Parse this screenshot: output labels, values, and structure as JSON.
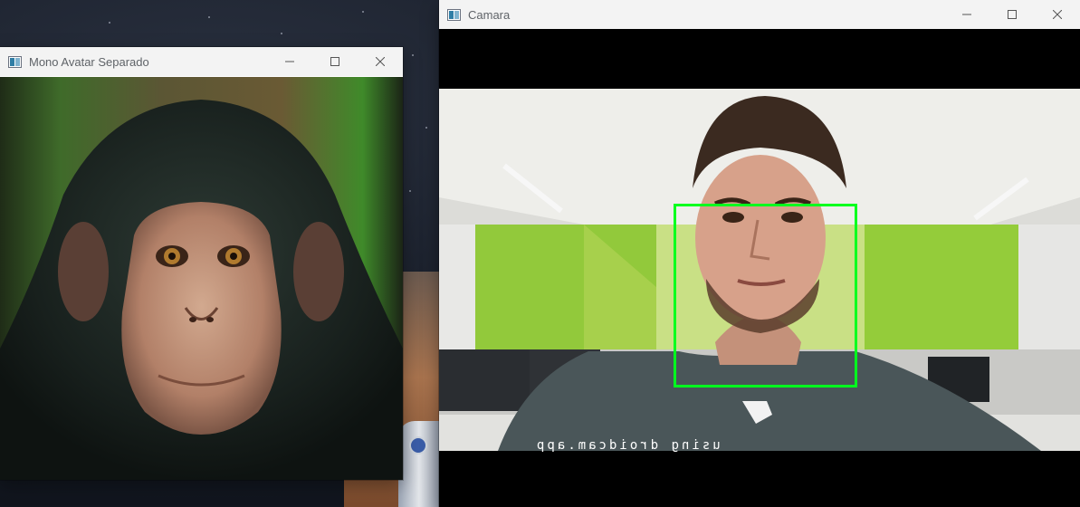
{
  "windows": {
    "avatar": {
      "title": "Mono Avatar Separado",
      "controls": [
        "minimize-icon",
        "maximize-icon",
        "close-icon"
      ]
    },
    "camera": {
      "title": "Camara",
      "controls": [
        "minimize-icon",
        "maximize-icon",
        "close-icon"
      ],
      "overlay_text": "using droidcam.app",
      "face_box_color": "#00ff1e"
    }
  }
}
